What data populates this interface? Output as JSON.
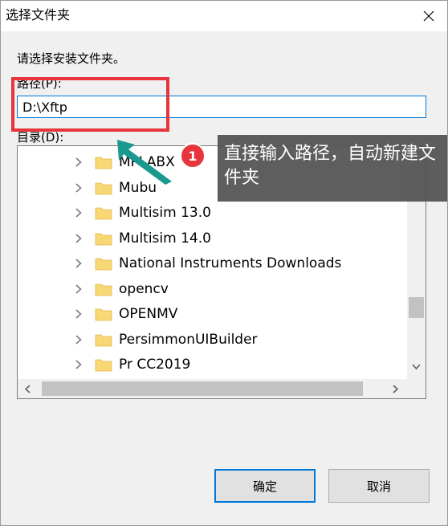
{
  "window": {
    "title": "选择文件夹"
  },
  "prompt": "请选择安装文件夹。",
  "path": {
    "label": "路径(P):",
    "value": "D:\\Xftp"
  },
  "directory": {
    "label": "目录(D):",
    "items": [
      {
        "label": "MPLABX"
      },
      {
        "label": "Mubu"
      },
      {
        "label": "Multisim 13.0"
      },
      {
        "label": "Multisim 14.0"
      },
      {
        "label": "National Instruments Downloads"
      },
      {
        "label": "opencv"
      },
      {
        "label": "OPENMV"
      },
      {
        "label": "PersimmonUIBuilder"
      },
      {
        "label": "Pr CC2019"
      }
    ]
  },
  "buttons": {
    "ok": "确定",
    "cancel": "取消"
  },
  "annotation": {
    "badge": "1",
    "text": "直接输入路径，自动新建文件夹"
  },
  "colors": {
    "accent": "#0078d7",
    "highlight": "#e8343c",
    "arrow": "#1a9a8e",
    "folder": "#f8d775"
  }
}
